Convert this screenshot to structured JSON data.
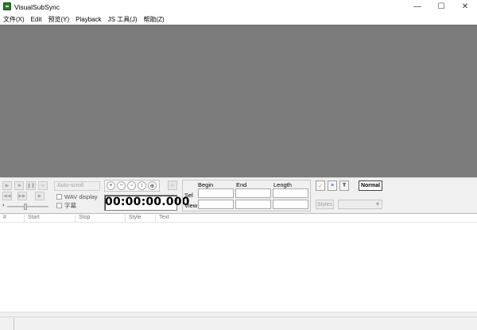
{
  "window": {
    "title": "VisualSubSync",
    "minimize": "—",
    "maximize": "☐",
    "close": "✕"
  },
  "menu": [
    {
      "label": "文件(X)"
    },
    {
      "label": "Edit"
    },
    {
      "label": "预览(Y)"
    },
    {
      "label": "Playback"
    },
    {
      "label": "JS 工具(J)"
    },
    {
      "label": "帮助(Z)"
    }
  ],
  "playback": {
    "buttons": [
      {
        "name": "play-icon",
        "glyph": "▶"
      },
      {
        "name": "stop-icon",
        "glyph": "■"
      },
      {
        "name": "pause-icon",
        "glyph": "❚❚"
      },
      {
        "name": "loop-icon",
        "glyph": "∞"
      },
      {
        "name": "skip-back-icon",
        "glyph": "◀◀"
      },
      {
        "name": "fast-forward-icon",
        "glyph": "▶▶"
      },
      {
        "name": "play-to-end-icon",
        "glyph": "▶"
      }
    ],
    "volume_icon": "speaker-icon"
  },
  "options": {
    "autoscroll": "Auto-scroll",
    "wav_display": "WAV display",
    "subtitles": "字幕"
  },
  "zoom_icons": [
    "zoom-in-icon",
    "zoom-out-icon",
    "zoom-selection-icon",
    "zoom-vertical-icon",
    "zoom-all-icon"
  ],
  "time": {
    "display": "00:00:00.000"
  },
  "selection": {
    "begin_label": "Begin",
    "end_label": "End",
    "length_label": "Length",
    "sel_label": "Sel",
    "view_label": "View"
  },
  "right_tools": {
    "normal_label": "Normal",
    "styles_label": "Styles"
  },
  "list": {
    "columns": [
      "#",
      "Start",
      "Stop",
      "Style",
      "Text"
    ]
  },
  "colors": {
    "video_bg": "#7b7b7b",
    "panel_bg": "#f0f0f0"
  }
}
